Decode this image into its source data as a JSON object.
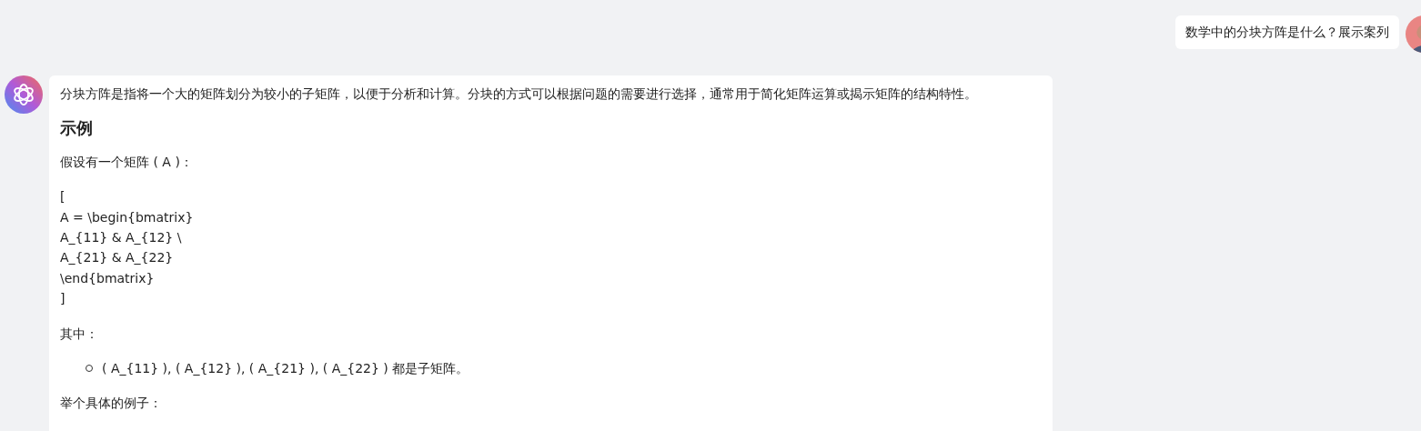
{
  "user_message": {
    "text": "数学中的分块方阵是什么？展示案列"
  },
  "assistant_message": {
    "blocks": [
      {
        "kind": "paragraph",
        "text": "分块方阵是指将一个大的矩阵划分为较小的子矩阵，以便于分析和计算。分块的方式可以根据问题的需要进行选择，通常用于简化矩阵运算或揭示矩阵的结构特性。"
      },
      {
        "kind": "heading",
        "text": "示例"
      },
      {
        "kind": "paragraph",
        "text": "假设有一个矩阵 ( A )："
      },
      {
        "kind": "lines",
        "lines": [
          "[",
          "A = \\begin{bmatrix}",
          "A_{11} & A_{12} \\",
          "A_{21} & A_{22}",
          "\\end{bmatrix}",
          "]"
        ]
      },
      {
        "kind": "paragraph",
        "text": "其中："
      },
      {
        "kind": "list",
        "items": [
          "( A_{11} ), ( A_{12} ), ( A_{21} ), ( A_{22} ) 都是子矩阵。"
        ]
      },
      {
        "kind": "paragraph",
        "text": "举个具体的例子："
      }
    ]
  }
}
